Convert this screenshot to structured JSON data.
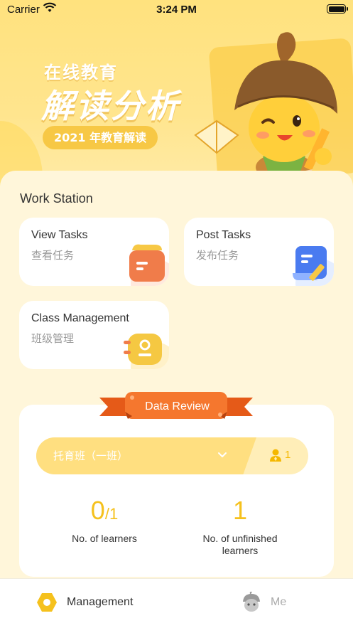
{
  "status_bar": {
    "carrier": "Carrier",
    "time": "3:24 PM"
  },
  "banner": {
    "subtitle": "在线教育",
    "title": "解读分析",
    "pill": "2021 年教育解读"
  },
  "work_station": {
    "title": "Work Station",
    "cards": [
      {
        "title": "View Tasks",
        "subtitle": "查看任务",
        "icon": "folder-icon",
        "icon_color": "#F07C4A"
      },
      {
        "title": "Post Tasks",
        "subtitle": "发布任务",
        "icon": "document-edit-icon",
        "icon_color": "#4A7BF0"
      },
      {
        "title": "Class Management",
        "subtitle": "班级管理",
        "icon": "notebook-icon",
        "icon_color": "#F5C842"
      }
    ]
  },
  "data_review": {
    "label": "Data Review",
    "class_selector": {
      "value": "托育班（一班）"
    },
    "teacher_count": "1",
    "stats": {
      "learners": {
        "value": "0",
        "total": "/1",
        "label": "No. of learners"
      },
      "unfinished": {
        "value": "1",
        "label": "No. of unfinished learners"
      }
    }
  },
  "tab_bar": {
    "items": [
      {
        "label": "Management",
        "icon": "hexagon-icon",
        "active": true
      },
      {
        "label": "Me",
        "icon": "acorn-avatar-icon",
        "active": false
      }
    ]
  },
  "colors": {
    "accent": "#F5C11D",
    "background": "#FFF6DA",
    "ribbon": "#F26B24",
    "class_bar": "#FFDF80"
  }
}
